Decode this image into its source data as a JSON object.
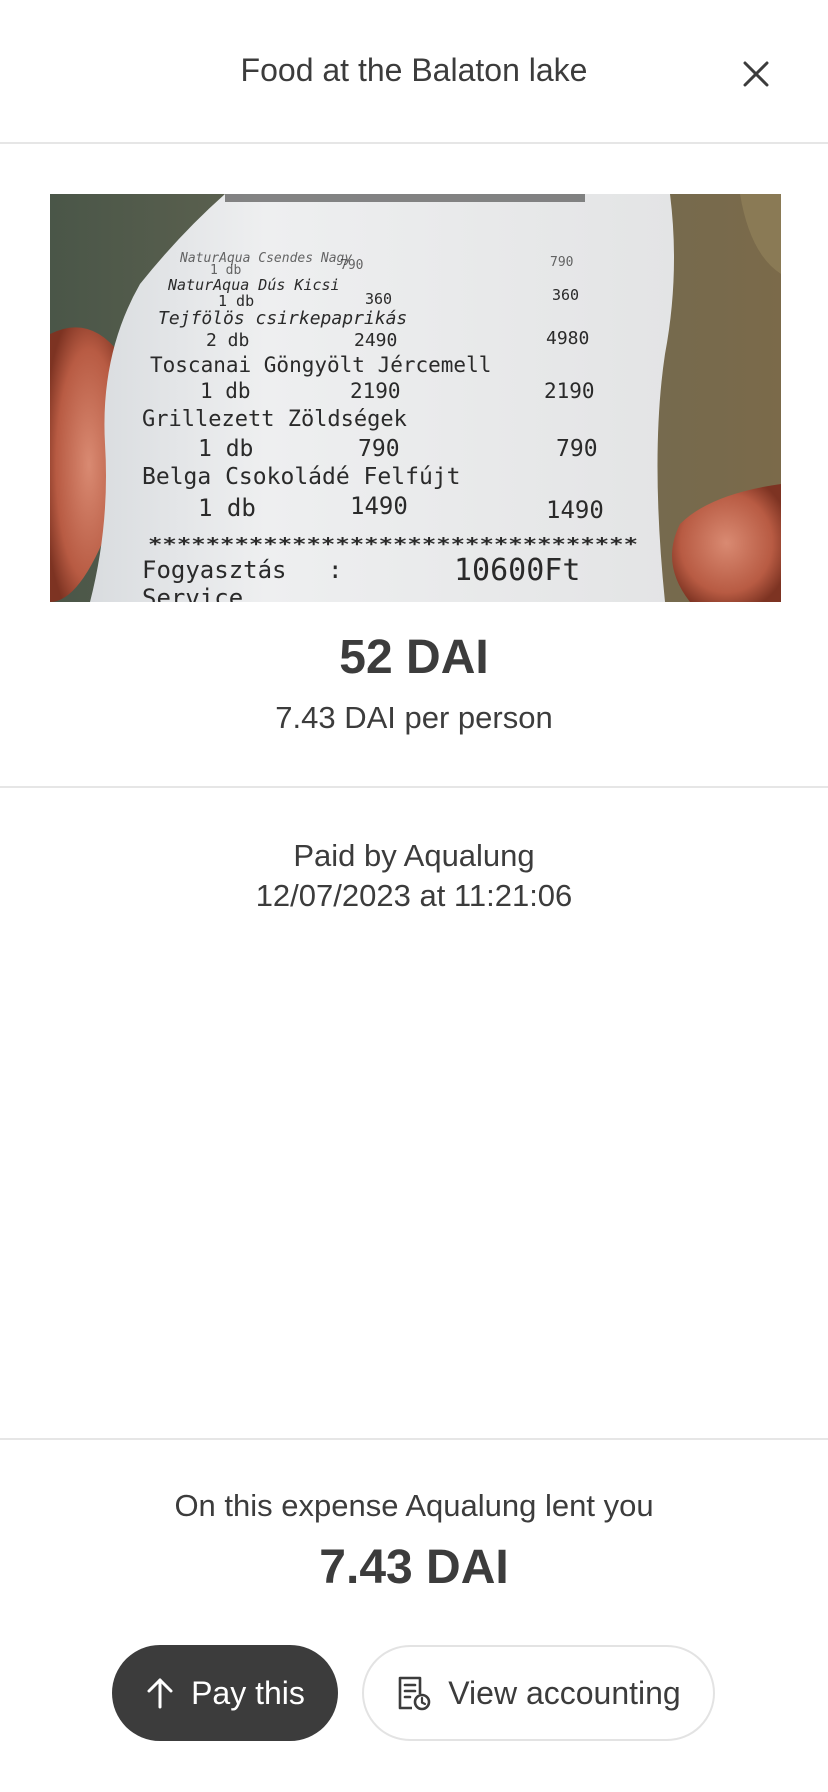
{
  "header": {
    "title": "Food at the Balaton lake",
    "close_icon": "close-icon"
  },
  "receipt": {
    "lines": [
      {
        "left": "NaturAqua Csendes Nagy",
        "mid": "",
        "right": ""
      },
      {
        "left": "1 db",
        "mid": "790",
        "right": "790"
      },
      {
        "left": "NaturAqua Dús Kicsi",
        "mid": "",
        "right": ""
      },
      {
        "left": "1 db",
        "mid": "360",
        "right": "360"
      },
      {
        "left": "Tejfölös csirkepaprikás",
        "mid": "",
        "right": ""
      },
      {
        "left": "2 db",
        "mid": "2490",
        "right": "4980"
      },
      {
        "left": "Toscanai Göngyölt Jércemell",
        "mid": "",
        "right": ""
      },
      {
        "left": "1 db",
        "mid": "2190",
        "right": "2190"
      },
      {
        "left": "Grillezett Zöldségek",
        "mid": "",
        "right": ""
      },
      {
        "left": "1 db",
        "mid": "790",
        "right": "790"
      },
      {
        "left": "Belga Csokoládé Felfújt",
        "mid": "",
        "right": ""
      },
      {
        "left": "1 db",
        "mid": "1490",
        "right": "1490"
      }
    ],
    "separator": "**********************************",
    "total_label": "Fogyasztás",
    "total_colon": ":",
    "total_value": "10600Ft",
    "service_label": "Service"
  },
  "expense": {
    "amount": "52 DAI",
    "per_person": "7.43 DAI per person",
    "paid_by": "Paid by Aqualung",
    "date": "12/07/2023 at 11:21:06"
  },
  "balance": {
    "text": "On this expense Aqualung lent you",
    "amount": "7.43 DAI"
  },
  "actions": {
    "pay_label": "Pay this",
    "pay_icon": "arrow-up-icon",
    "view_label": "View accounting",
    "view_icon": "receipt-icon"
  }
}
